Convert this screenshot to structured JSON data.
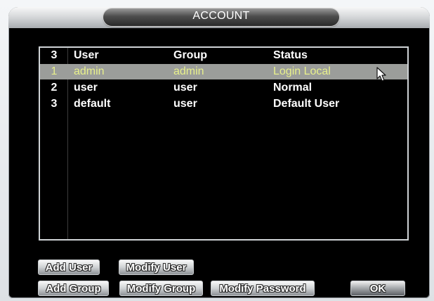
{
  "window": {
    "title": "ACCOUNT"
  },
  "table": {
    "headers": {
      "index": "3",
      "user": "User",
      "group": "Group",
      "status": "Status"
    },
    "rows": [
      {
        "index": "1",
        "user": "admin",
        "group": "admin",
        "status": "Login Local",
        "selected": true
      },
      {
        "index": "2",
        "user": "user",
        "group": "user",
        "status": "Normal",
        "selected": false
      },
      {
        "index": "3",
        "user": "default",
        "group": "user",
        "status": "Default User",
        "selected": false
      }
    ]
  },
  "buttons": {
    "add_user": "Add User",
    "modify_user": "Modify User",
    "add_group": "Add Group",
    "modify_group": "Modify Group",
    "modify_password": "Modify Password",
    "ok": "OK"
  },
  "colors": {
    "selected_row_bg": "#9b9d9a",
    "selected_row_text": "#e8f08c",
    "text": "#ffffff",
    "background": "#000000"
  },
  "icons": {
    "pointer": "mouse-pointer-icon"
  }
}
